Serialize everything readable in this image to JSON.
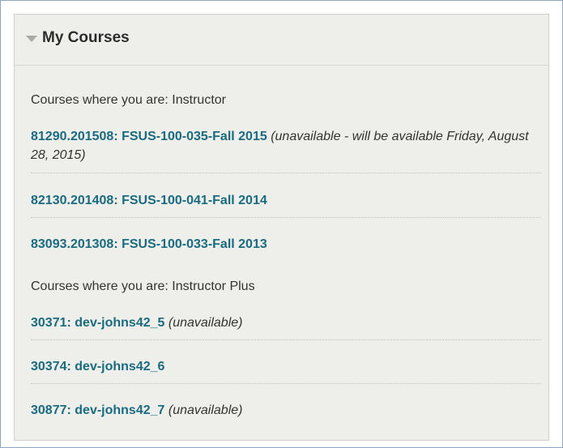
{
  "module": {
    "title": "My Courses",
    "toggle_icon": "triangle-down-icon"
  },
  "sections": [
    {
      "heading": "Courses where you are: Instructor",
      "courses": [
        {
          "name": "81290.201508: FSUS-100-035-Fall 2015",
          "note": "(unavailable - will be available Friday, August 28, 2015)"
        },
        {
          "name": "82130.201408: FSUS-100-041-Fall 2014",
          "note": ""
        },
        {
          "name": "83093.201308: FSUS-100-033-Fall 2013",
          "note": ""
        }
      ]
    },
    {
      "heading": "Courses where you are: Instructor Plus",
      "courses": [
        {
          "name": "30371: dev-johns42_5",
          "note": "(unavailable)"
        },
        {
          "name": "30374: dev-johns42_6",
          "note": ""
        },
        {
          "name": "30877: dev-johns42_7",
          "note": "(unavailable)"
        }
      ]
    }
  ],
  "colors": {
    "link": "#1a6b80",
    "module_background": "#eeeeea",
    "frame_border": "#8aa6c4"
  }
}
